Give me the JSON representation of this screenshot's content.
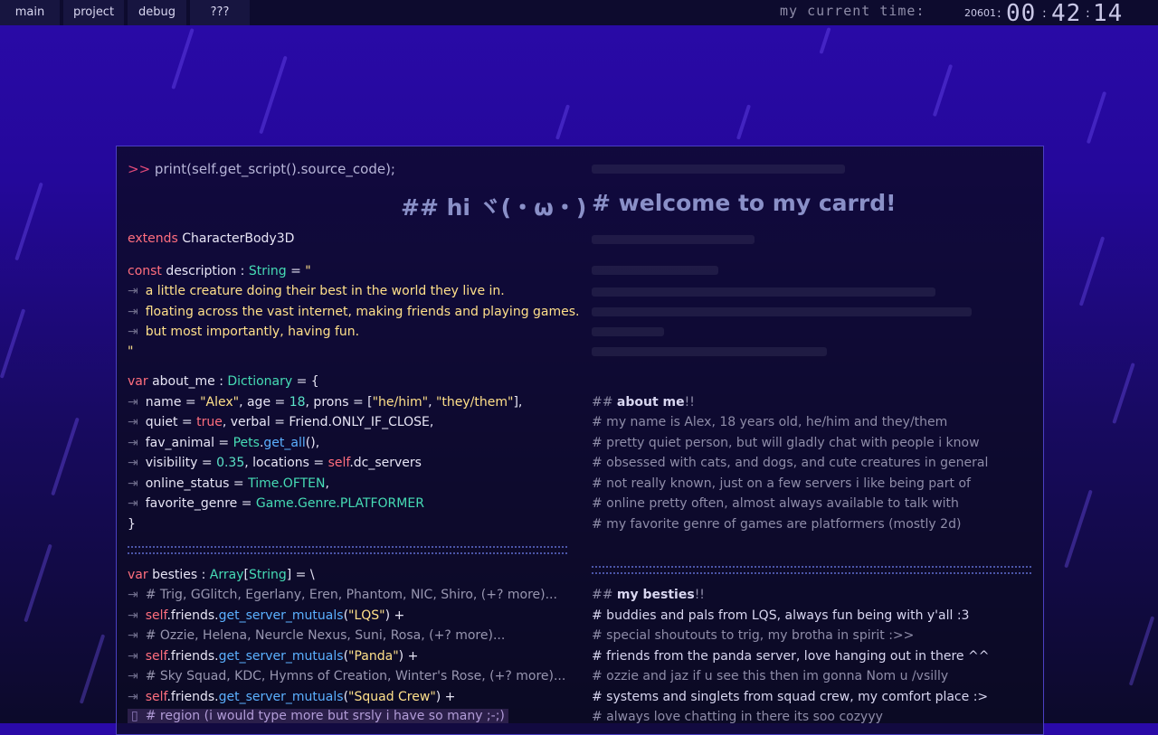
{
  "nav": {
    "tabs": [
      {
        "label": "main"
      },
      {
        "label": "project"
      },
      {
        "label": "debug"
      },
      {
        "label": "???"
      }
    ]
  },
  "clock": {
    "label": "my current time:",
    "year": "20601",
    "hours": "00",
    "minutes": "42",
    "seconds": "14"
  },
  "code": {
    "prompt": ">>",
    "command": "print(self.get_script().source_code);",
    "extends_kw": "extends",
    "extends_class": "CharacterBody3D",
    "desc_const": "const",
    "desc_name": "description",
    "desc_type": "String",
    "desc_lines": [
      "a little creature doing their best in the world they live in.",
      "floating across the vast internet, making friends and playing games.",
      "but most importantly, having fun."
    ],
    "var_kw": "var",
    "about_name": "about_me",
    "about_type": "Dictionary",
    "about_lines": {
      "name": "\"Alex\"",
      "age": "18",
      "pron1": "\"he/him\"",
      "pron2": "\"they/them\"",
      "quiet_val": "true",
      "verbal_val": "Friend.ONLY_IF_CLOSE",
      "pets": "Pets",
      "get_all": "get_all",
      "visibility": "0.35",
      "self": "self",
      "dc_servers": ".dc_servers",
      "online": "Time.OFTEN",
      "genre": "Game.Genre.PLATFORMER"
    },
    "besties_name": "besties",
    "besties_type": "Array",
    "besties_sub": "String",
    "besties": [
      {
        "comment": "# Trig, GGlitch, Egerlany, Eren, Phantom, NIC, Shiro, (+? more)...",
        "server": "\"LQS\""
      },
      {
        "comment": "# Ozzie, Helena, Neurcle Nexus, Suni, Rosa, (+? more)...",
        "server": "\"Panda\""
      },
      {
        "comment": "# Sky Squad, KDC, Hymns of Creation, Winter's Rose, (+? more)...",
        "server": "\"Squad Crew\""
      }
    ],
    "region": "# region (i would type more but srsly i have so many ;-;)"
  },
  "right": {
    "hi_heading": "## hi ヾ(・ω・)",
    "welcome_heading": "# welcome to my carrd!",
    "about_heading_prefix": "##",
    "about_heading_bold": "about me",
    "about_heading_suffix": "!!",
    "about_lines": [
      "# my name is Alex, 18 years old, he/him and they/them",
      "# pretty quiet person, but will gladly chat with people i know",
      "# obsessed with cats, and dogs, and cute creatures in general",
      "# not really known, just on a few servers i like being part of",
      "# online pretty often, almost always available to talk with",
      "# my favorite genre of games are platformers (mostly 2d)"
    ],
    "besties_heading_prefix": "##",
    "besties_heading_bold": "my besties",
    "besties_heading_suffix": "!!",
    "besties_lines": [
      "# buddies and pals from LQS, always fun being with y'all :3",
      "# special shoutouts to trig, my brotha in spirit :>>",
      "# friends from the panda server, love hanging out in there ^^",
      "# ozzie and jaz if u see this then im gonna Nom u /vsilly",
      "# systems and singlets from squad crew, my comfort place :>",
      "# always love chatting in there its soo cozyyy"
    ]
  },
  "colors": {
    "accent_border": "#4b3fc2",
    "keyword": "#ff6e7e",
    "type": "#46dcb5",
    "function": "#5bb0ff",
    "string": "#ffe08a"
  }
}
